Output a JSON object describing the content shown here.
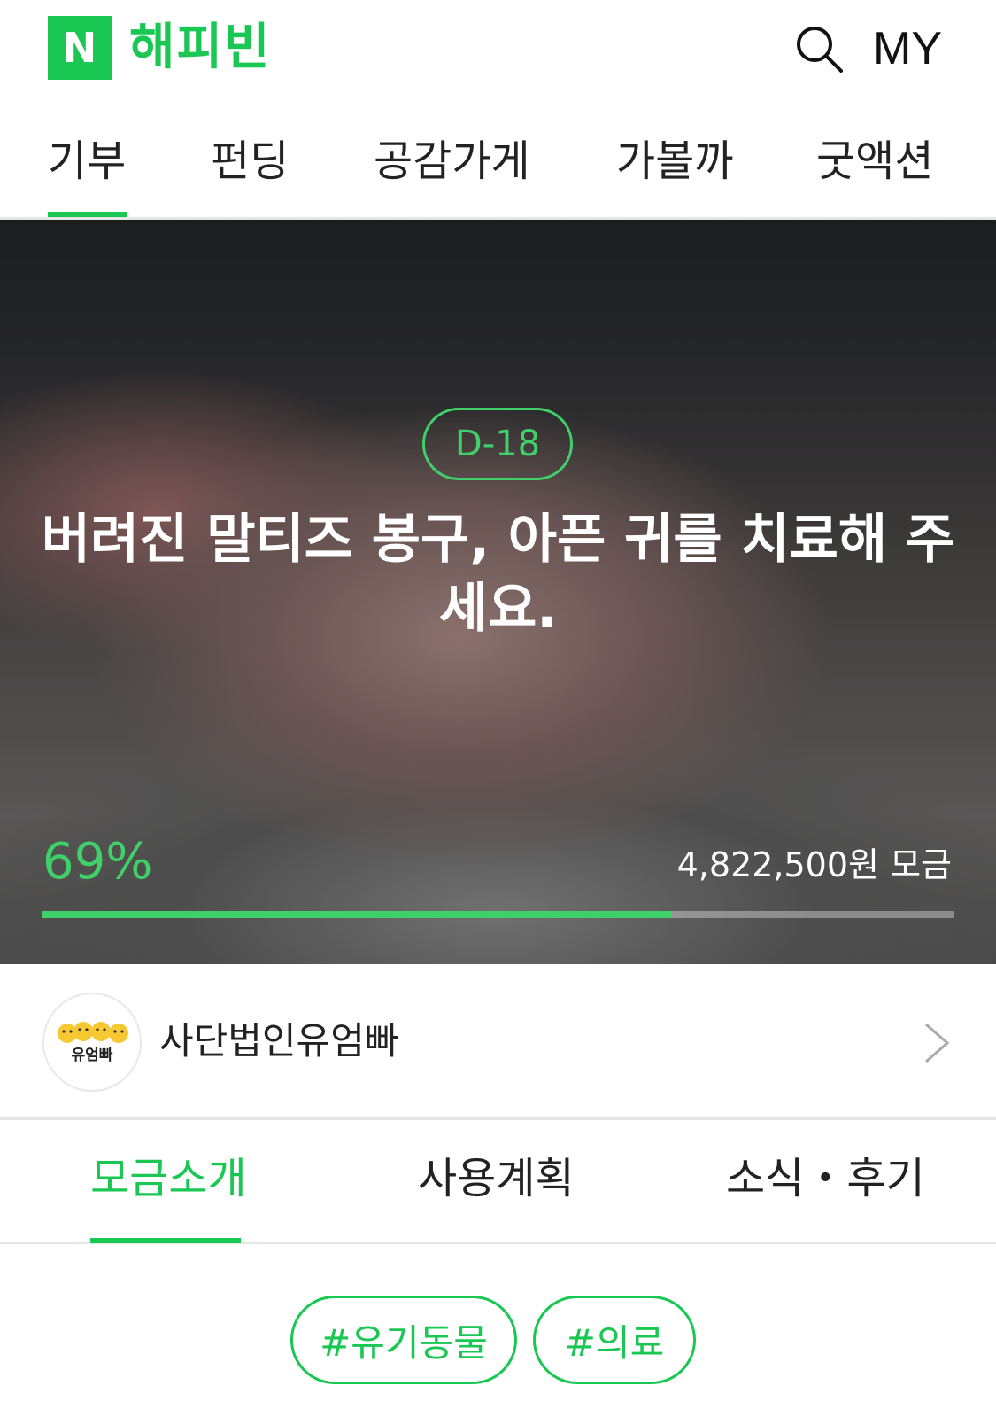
{
  "header": {
    "logo_letter": "N",
    "logo_text": "해피빈",
    "my_label": "MY",
    "brand_color": "#19c752"
  },
  "top_nav": {
    "tabs": [
      {
        "label": "기부",
        "active": true
      },
      {
        "label": "펀딩",
        "active": false
      },
      {
        "label": "공감가게",
        "active": false
      },
      {
        "label": "가볼까",
        "active": false
      },
      {
        "label": "굿액션",
        "active": false
      }
    ]
  },
  "campaign": {
    "dday": "D-18",
    "title": "버려진 말티즈 봉구, 아픈 귀를 치료해 주세요.",
    "percent_label": "69%",
    "progress_fraction": 0.69,
    "raised_label": "4,822,500원 모금"
  },
  "organization": {
    "name": "사단법인유엄빠",
    "avatar_text": "유엄빠",
    "icon": "chevron-right-icon"
  },
  "content_tabs": {
    "tabs": [
      {
        "label": "모금소개",
        "active": true
      },
      {
        "label": "사용계획",
        "active": false
      },
      {
        "label": "소식・후기",
        "active": false
      }
    ]
  },
  "hashtags": [
    "#유기동물",
    "#의료"
  ]
}
